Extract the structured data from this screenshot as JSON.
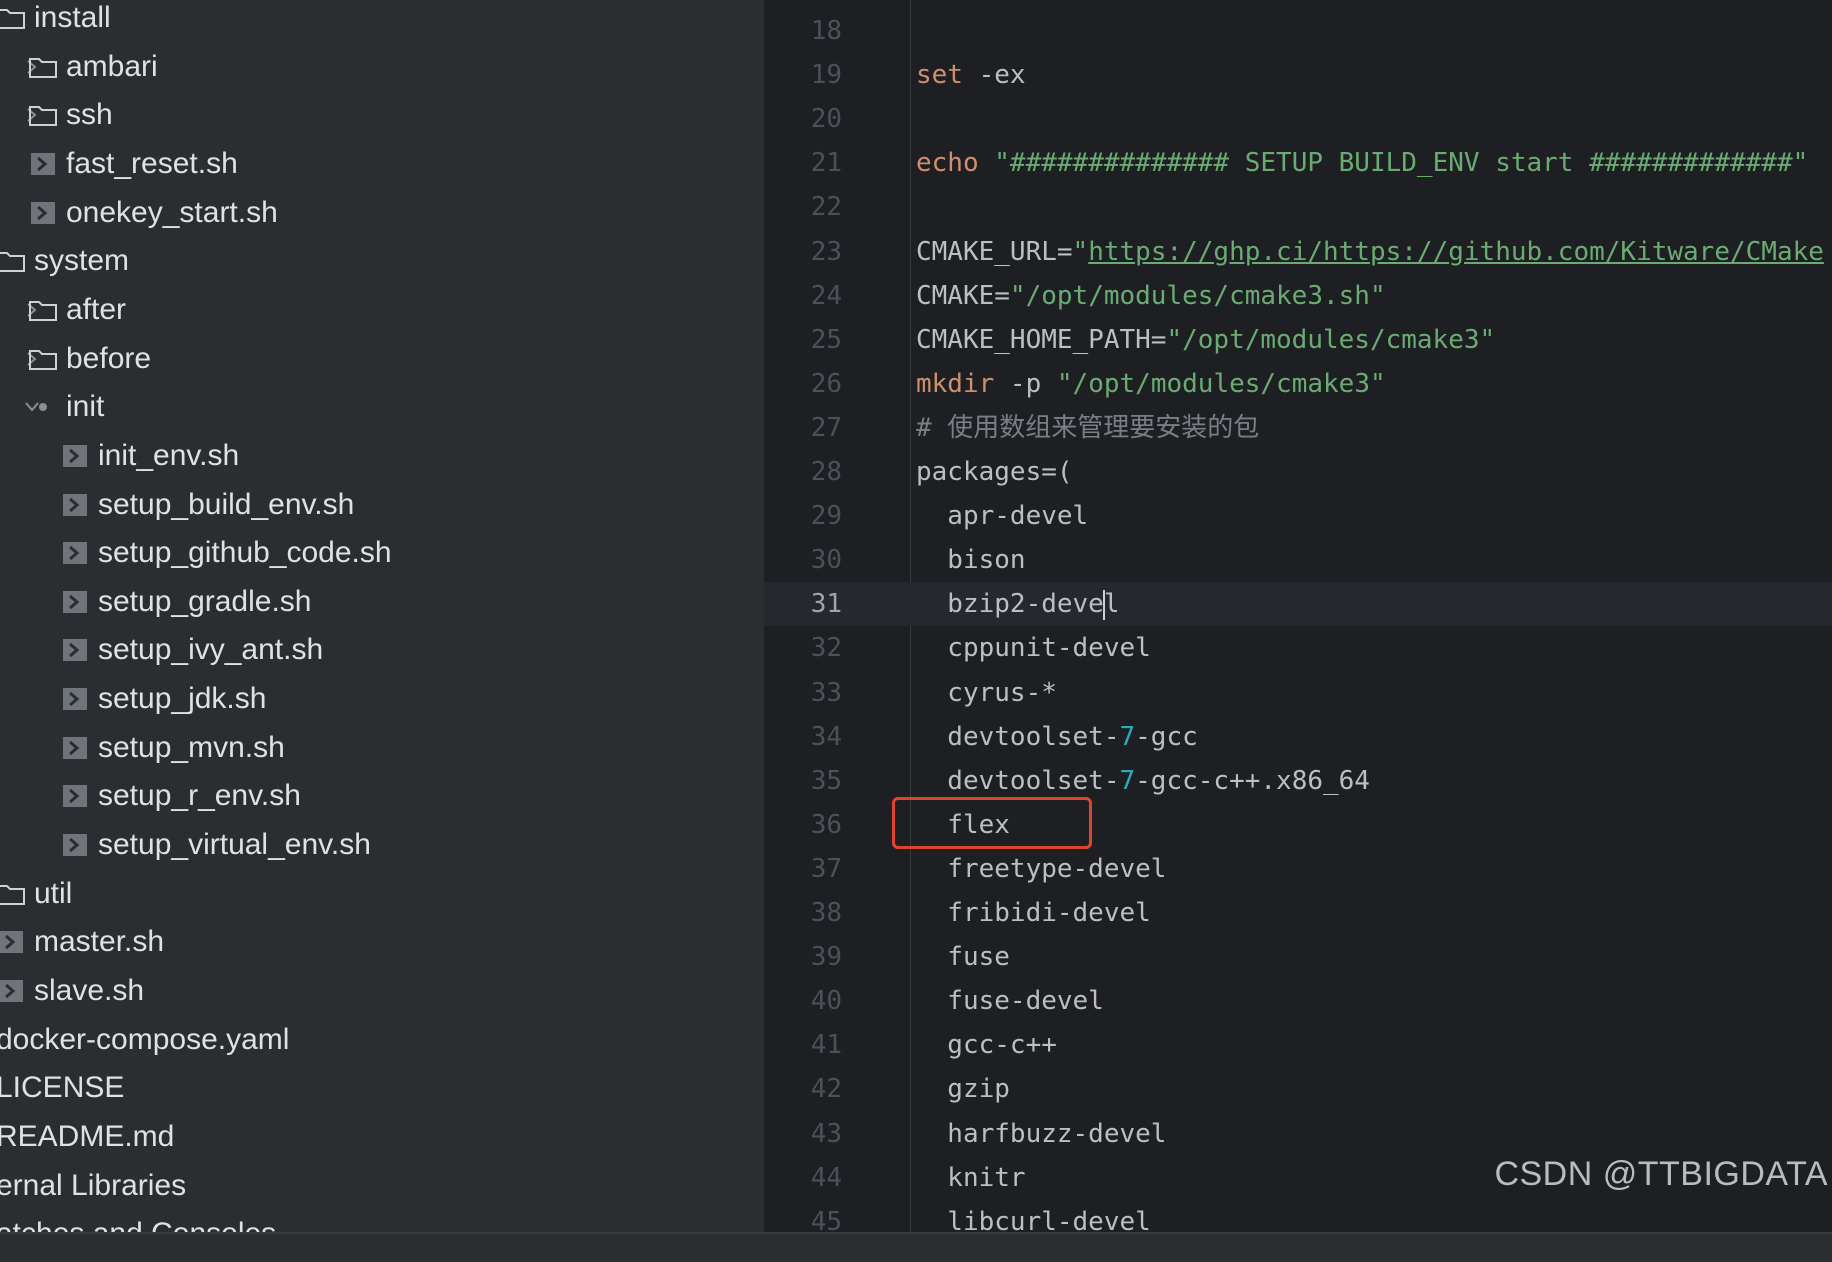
{
  "project_tree": {
    "items": [
      {
        "label": "install",
        "icon": "folder-icon",
        "arrow": "none"
      },
      {
        "label": "ambari",
        "icon": "folder-icon",
        "arrow": "chevron-right-icon"
      },
      {
        "label": "ssh",
        "icon": "folder-icon",
        "arrow": "chevron-right-icon"
      },
      {
        "label": "fast_reset.sh",
        "icon": "shell-script-icon",
        "arrow": "none"
      },
      {
        "label": "onekey_start.sh",
        "icon": "shell-script-icon",
        "arrow": "none"
      },
      {
        "label": "system",
        "icon": "folder-icon",
        "arrow": "none"
      },
      {
        "label": "after",
        "icon": "folder-icon",
        "arrow": "chevron-right-icon"
      },
      {
        "label": "before",
        "icon": "folder-icon",
        "arrow": "chevron-right-icon"
      },
      {
        "label": "init",
        "icon": "package-dot-icon",
        "arrow": "chevron-down-icon"
      },
      {
        "label": "init_env.sh",
        "icon": "shell-script-icon",
        "arrow": "none"
      },
      {
        "label": "setup_build_env.sh",
        "icon": "shell-script-icon",
        "arrow": "none"
      },
      {
        "label": "setup_github_code.sh",
        "icon": "shell-script-icon",
        "arrow": "none"
      },
      {
        "label": "setup_gradle.sh",
        "icon": "shell-script-icon",
        "arrow": "none"
      },
      {
        "label": "setup_ivy_ant.sh",
        "icon": "shell-script-icon",
        "arrow": "none"
      },
      {
        "label": "setup_jdk.sh",
        "icon": "shell-script-icon",
        "arrow": "none"
      },
      {
        "label": "setup_mvn.sh",
        "icon": "shell-script-icon",
        "arrow": "none"
      },
      {
        "label": "setup_r_env.sh",
        "icon": "shell-script-icon",
        "arrow": "none"
      },
      {
        "label": "setup_virtual_env.sh",
        "icon": "shell-script-icon",
        "arrow": "none"
      },
      {
        "label": "util",
        "icon": "folder-icon",
        "arrow": "none"
      },
      {
        "label": "master.sh",
        "icon": "shell-script-icon",
        "arrow": "none"
      },
      {
        "label": "slave.sh",
        "icon": "shell-script-icon",
        "arrow": "none"
      },
      {
        "label": "docker-compose.yaml",
        "icon": "none",
        "arrow": "none"
      },
      {
        "label": "LICENSE",
        "icon": "none",
        "arrow": "none"
      },
      {
        "label": "README.md",
        "icon": "none",
        "arrow": "none"
      },
      {
        "label": "ernal Libraries",
        "icon": "none",
        "arrow": "none"
      },
      {
        "label": "atches and Consoles",
        "icon": "none",
        "arrow": "none"
      }
    ]
  },
  "editor": {
    "current_line": 31,
    "highlighted_line": 36,
    "lines": [
      {
        "no": "18",
        "tokens": []
      },
      {
        "no": "19",
        "tokens": [
          {
            "t": "set",
            "c": "kw"
          },
          {
            "t": " -ex",
            "c": ""
          }
        ]
      },
      {
        "no": "20",
        "tokens": []
      },
      {
        "no": "21",
        "tokens": [
          {
            "t": "echo",
            "c": "kw"
          },
          {
            "t": " ",
            "c": ""
          },
          {
            "t": "\"############## SETUP BUILD_ENV start #############\"",
            "c": "str"
          }
        ]
      },
      {
        "no": "22",
        "tokens": []
      },
      {
        "no": "23",
        "tokens": [
          {
            "t": "CMAKE_URL=",
            "c": ""
          },
          {
            "t": "\"",
            "c": "str"
          },
          {
            "t": "https://ghp.ci/https://github.com/Kitware/CMake",
            "c": "url"
          }
        ]
      },
      {
        "no": "24",
        "tokens": [
          {
            "t": "CMAKE=",
            "c": ""
          },
          {
            "t": "\"/opt/modules/cmake3.sh\"",
            "c": "str"
          }
        ]
      },
      {
        "no": "25",
        "tokens": [
          {
            "t": "CMAKE_HOME_PATH=",
            "c": ""
          },
          {
            "t": "\"/opt/modules/cmake3\"",
            "c": "str"
          }
        ]
      },
      {
        "no": "26",
        "tokens": [
          {
            "t": "mkdir",
            "c": "kw"
          },
          {
            "t": " -p ",
            "c": ""
          },
          {
            "t": "\"/opt/modules/cmake3\"",
            "c": "str"
          }
        ]
      },
      {
        "no": "27",
        "tokens": [
          {
            "t": "# 使用数组来管理要安装的包",
            "c": "cmt"
          }
        ]
      },
      {
        "no": "28",
        "tokens": [
          {
            "t": "packages=(",
            "c": ""
          }
        ]
      },
      {
        "no": "29",
        "tokens": [
          {
            "t": "  apr-devel",
            "c": ""
          }
        ]
      },
      {
        "no": "30",
        "tokens": [
          {
            "t": "  bison",
            "c": ""
          }
        ]
      },
      {
        "no": "31",
        "tokens": [
          {
            "t": "  bzip2-deve",
            "c": ""
          },
          {
            "t": "",
            "c": "caret"
          },
          {
            "t": "l",
            "c": ""
          }
        ]
      },
      {
        "no": "32",
        "tokens": [
          {
            "t": "  cppunit-devel",
            "c": ""
          }
        ]
      },
      {
        "no": "33",
        "tokens": [
          {
            "t": "  cyrus-*",
            "c": ""
          }
        ]
      },
      {
        "no": "34",
        "tokens": [
          {
            "t": "  devtoolset-",
            "c": ""
          },
          {
            "t": "7",
            "c": "num"
          },
          {
            "t": "-gcc",
            "c": ""
          }
        ]
      },
      {
        "no": "35",
        "tokens": [
          {
            "t": "  devtoolset-",
            "c": ""
          },
          {
            "t": "7",
            "c": "num"
          },
          {
            "t": "-gcc-c++.x86_64",
            "c": ""
          }
        ]
      },
      {
        "no": "36",
        "tokens": [
          {
            "t": "  flex",
            "c": ""
          }
        ]
      },
      {
        "no": "37",
        "tokens": [
          {
            "t": "  freetype-devel",
            "c": ""
          }
        ]
      },
      {
        "no": "38",
        "tokens": [
          {
            "t": "  fribidi-devel",
            "c": ""
          }
        ]
      },
      {
        "no": "39",
        "tokens": [
          {
            "t": "  fuse",
            "c": ""
          }
        ]
      },
      {
        "no": "40",
        "tokens": [
          {
            "t": "  fuse-devel",
            "c": ""
          }
        ]
      },
      {
        "no": "41",
        "tokens": [
          {
            "t": "  gcc-c++",
            "c": ""
          }
        ]
      },
      {
        "no": "42",
        "tokens": [
          {
            "t": "  gzip",
            "c": ""
          }
        ]
      },
      {
        "no": "43",
        "tokens": [
          {
            "t": "  harfbuzz-devel",
            "c": ""
          }
        ]
      },
      {
        "no": "44",
        "tokens": [
          {
            "t": "  knitr",
            "c": ""
          }
        ]
      },
      {
        "no": "45",
        "tokens": [
          {
            "t": "  libcurl-devel",
            "c": ""
          }
        ]
      }
    ]
  },
  "watermark": "CSDN @TTBIGDATA",
  "colors": {
    "keyword": "#cf8e6d",
    "string": "#6aab73",
    "number": "#2aacb8",
    "comment": "#7a7e85",
    "highlight_box": "#e0442e"
  }
}
